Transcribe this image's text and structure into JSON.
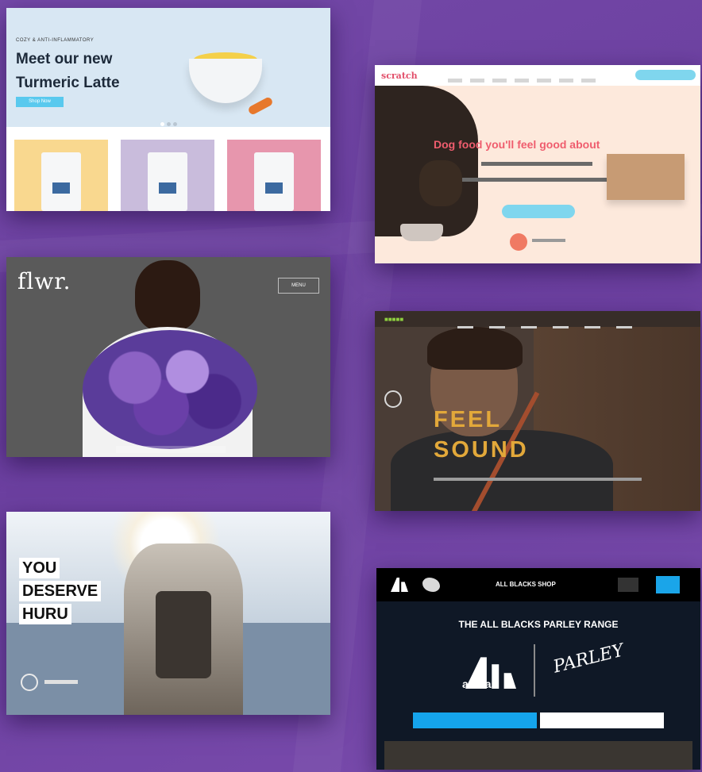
{
  "showcase": {
    "turmeric": {
      "eyebrow": "COZY & ANTI-INFLAMMATORY",
      "title": "Meet our new Turmeric Latte",
      "cta": "Shop Now",
      "colors": {
        "hero": "#d8e7f3",
        "accent": "#59c9ee"
      },
      "tiles": [
        {
          "color": "#f9d88f"
        },
        {
          "color": "#c9bcdc"
        },
        {
          "color": "#e796ad"
        }
      ]
    },
    "scratch": {
      "logo": "scratch",
      "headline": "Dog food you'll feel good about",
      "colors": {
        "background": "#fde9dc",
        "accent": "#ef5d6e"
      }
    },
    "flwr": {
      "logo": "flwr.",
      "menu": "MENU"
    },
    "sound": {
      "headline_line1": "FEEL",
      "headline_line2": "SOUND"
    },
    "huru": {
      "headline": [
        "YOU",
        "DESERVE",
        "HURU"
      ]
    },
    "allblacks": {
      "shop": "ALL BLACKS SHOP",
      "title": "THE ALL BLACKS PARLEY RANGE",
      "brand1": "adidas",
      "brand2": "PARLEY"
    }
  }
}
